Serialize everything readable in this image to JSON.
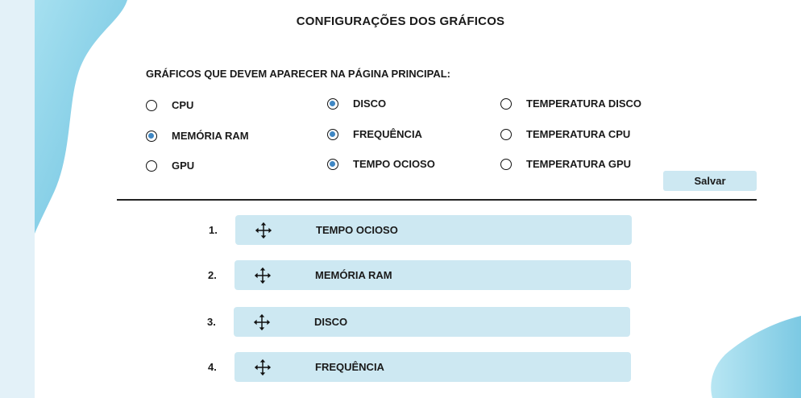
{
  "page": {
    "title": "CONFIGURAÇÕES DOS GRÁFICOS"
  },
  "charts_section": {
    "heading": "GRÁFICOS QUE DEVEM APARECER NA PÁGINA PRINCIPAL:",
    "options": [
      {
        "label": "CPU",
        "selected": false
      },
      {
        "label": "MEMÓRIA RAM",
        "selected": true
      },
      {
        "label": "GPU",
        "selected": false
      },
      {
        "label": "DISCO",
        "selected": true
      },
      {
        "label": "FREQUÊNCIA",
        "selected": true
      },
      {
        "label": "TEMPO OCIOSO",
        "selected": true
      },
      {
        "label": "TEMPERATURA DISCO",
        "selected": false
      },
      {
        "label": "TEMPERATURA CPU",
        "selected": false
      },
      {
        "label": "TEMPERATURA GPU",
        "selected": false
      }
    ],
    "save_label": "Salvar"
  },
  "order_list": [
    {
      "number": "1.",
      "label": "TEMPO OCIOSO"
    },
    {
      "number": "2.",
      "label": "MEMÓRIA RAM"
    },
    {
      "number": "3.",
      "label": "DISCO"
    },
    {
      "number": "4.",
      "label": "FREQUÊNCIA"
    }
  ],
  "icons": {
    "drag_handle": "move-arrows-icon"
  },
  "colors": {
    "accent": "#3f87c4",
    "row_bg": "#cde8f2",
    "side_bg": "#e3f1f8",
    "wave": "#8fd0e6"
  }
}
